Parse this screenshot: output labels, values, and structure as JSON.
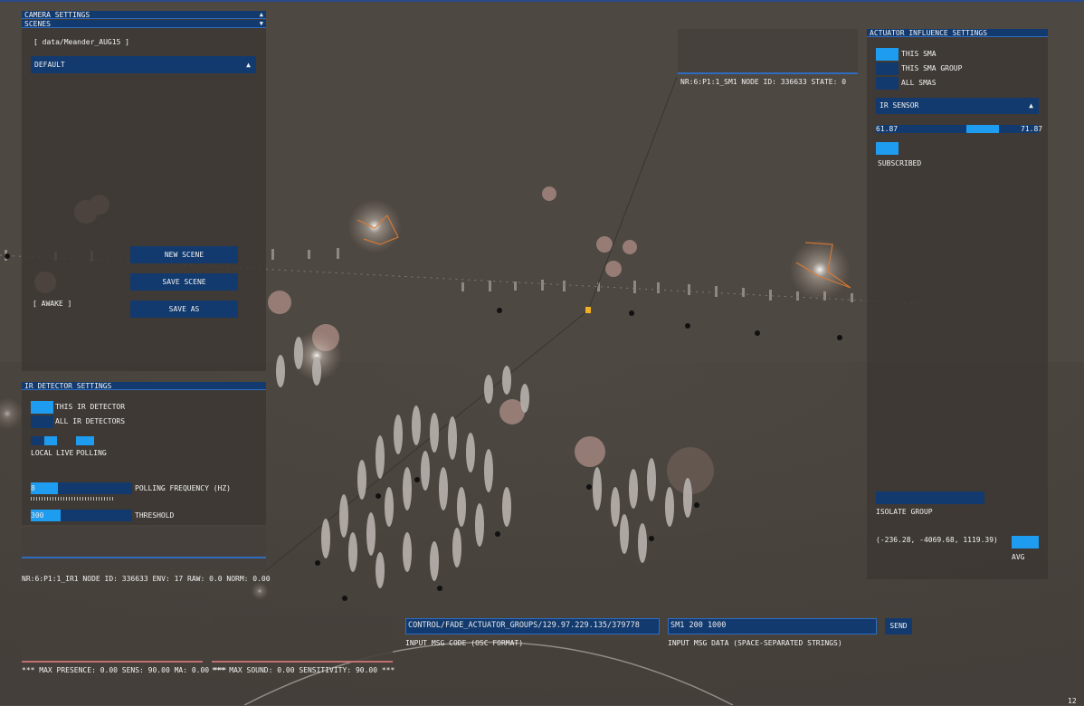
{
  "scenes_panel": {
    "camera_settings_label": "CAMERA SETTINGS",
    "scenes_label": "SCENES",
    "path": "[ data/Meander_AUG15 ]",
    "dropdown_value": "DEFAULT",
    "new_scene": "NEW SCENE",
    "save_scene": "SAVE SCENE",
    "save_as": "SAVE AS",
    "status": "[ AWAKE ]"
  },
  "ir_panel": {
    "title": "IR DETECTOR SETTINGS",
    "this_ir": "THIS IR DETECTOR",
    "all_ir": "ALL IR DETECTORS",
    "local": "LOCAL",
    "live": "LIVE",
    "polling": "POLLING",
    "polling_frequency_value": "8",
    "polling_frequency_label": "POLLING FREQUENCY (HZ)",
    "threshold_value": "300",
    "threshold_label": "THRESHOLD",
    "node_info": "NR:6:P1:1_IR1  NODE ID: 336633 ENV: 17 RAW: 0.0 NORM: 0.00"
  },
  "node_readout": {
    "text": "NR:6:P1:1_SM1  NODE ID: 336633 STATE: 0"
  },
  "actuator_panel": {
    "title": "ACTUATOR INFLUENCE SETTINGS",
    "this_sma": "THIS SMA",
    "this_sma_group": "THIS SMA GROUP",
    "all_smas": "ALL SMAS",
    "sensor_dropdown": "IR SENSOR",
    "range_min": "61.87",
    "range_max": "71.87",
    "subscribed": "SUBSCRIBED",
    "isolate_group": "ISOLATE GROUP",
    "coords": "(-236.28, -4069.68, 1119.39)",
    "avg": "AVG"
  },
  "bottom": {
    "presence": "*** MAX PRESENCE: 0.00  SENS: 90.00 MA: 0.00 ***",
    "sound": "*** MAX SOUND: 0.00  SENSITIVITY: 90.00 ***",
    "msg_code_value": "CONTROL/FADE_ACTUATOR_GROUPS/129.97.229.135/379778",
    "msg_code_label": "INPUT MSG CODE (OSC FORMAT)",
    "msg_data_value": "SM1 200 1000",
    "msg_data_label": "INPUT MSG DATA (SPACE-SEPARATED STRINGS)",
    "send": "SEND",
    "frame_counter": "12"
  },
  "colors": {
    "background": "#4e4842",
    "panel_blue": "#123a6e",
    "accent": "#1e9cf0"
  }
}
